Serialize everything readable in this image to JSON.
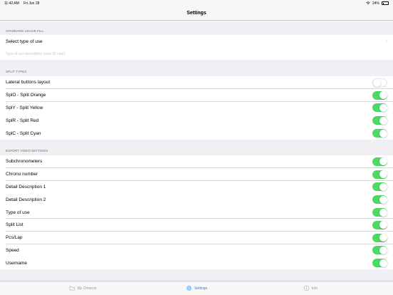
{
  "status_bar": {
    "time": "11:42 AM",
    "date": "Fri Jun 28",
    "battery": "24%",
    "battery_level": 0.24
  },
  "nav": {
    "title": "Settings"
  },
  "usage": {
    "header": "STANDARD USAGE FILL",
    "select_label": "Select type of use",
    "description_placeholder": "Type of use description (max 30 char)"
  },
  "split": {
    "header": "SPLIT TYPES",
    "rows": [
      {
        "label": "Lateral buttons layout",
        "on": false
      },
      {
        "label": "SplO - Split Orange",
        "on": true
      },
      {
        "label": "SplY - Split Yellow",
        "on": true
      },
      {
        "label": "SplR - Split Red",
        "on": true
      },
      {
        "label": "SplC - Split Cyan",
        "on": true
      }
    ]
  },
  "export": {
    "header": "EXPORT VIDEO SETTINGS",
    "rows": [
      {
        "label": "Subchronometers",
        "on": true
      },
      {
        "label": "Chrono number",
        "on": true
      },
      {
        "label": "Detail Description 1",
        "on": true
      },
      {
        "label": "Detail Description 2",
        "on": true
      },
      {
        "label": "Type of use",
        "on": true
      },
      {
        "label": "Split List",
        "on": true
      },
      {
        "label": "Pcs/Lap",
        "on": true
      },
      {
        "label": "Speed",
        "on": true
      },
      {
        "label": "Username",
        "on": true
      }
    ]
  },
  "tabs": [
    {
      "label": "My Chronos",
      "icon": "folder-icon",
      "active": false
    },
    {
      "label": "Settings",
      "icon": "gear-icon",
      "active": true
    },
    {
      "label": "Info",
      "icon": "info-icon",
      "active": false
    }
  ],
  "colors": {
    "switch_on": "#4cd964",
    "tint": "#1a82fb",
    "background": "#efeff4"
  }
}
